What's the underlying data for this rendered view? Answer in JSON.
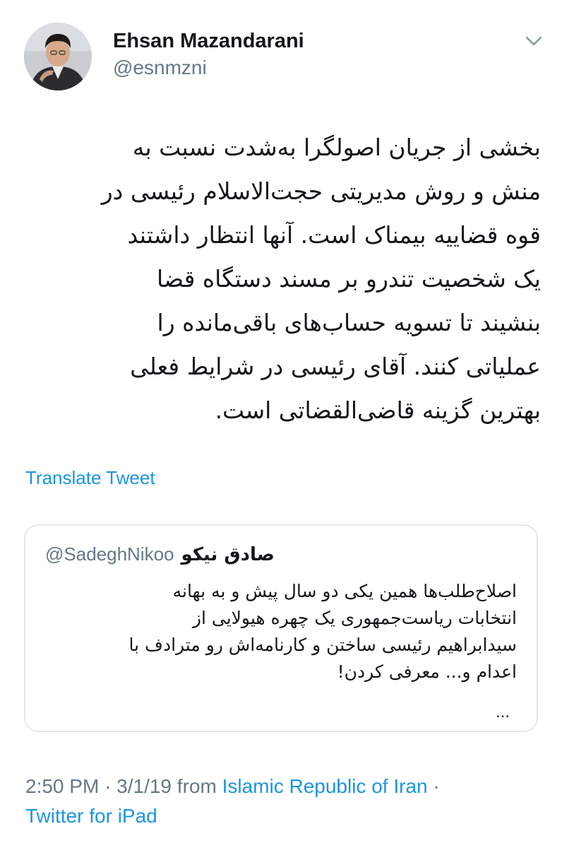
{
  "author": {
    "display_name": "Ehsan Mazandarani",
    "handle": "@esnmzni"
  },
  "tweet": {
    "lines": [
      "بخشی از جریان اصولگرا به‌شدت نسبت به",
      "منش و روش مدیریتی حجت‌الاسلام رئیسی در",
      "قوه قضاییه بیمناک است. آنها انتظار داشتند",
      "یک شخصیت تندرو بر مسند دستگاه قضا",
      "بنشیند تا تسویه حساب‌های باقی‌مانده را",
      "عملیاتی کنند. آقای رئیسی در شرایط فعلی",
      "بهترین گزینه قاضی‌القضاتی است."
    ],
    "translate_label": "Translate Tweet"
  },
  "quoted_tweet": {
    "name": "صادق نیکو",
    "handle": "@SadeghNikoo",
    "lines": [
      "اصلاح‌طلب‌ها همین یکی دو سال پیش و به بهانه",
      "انتخابات ریاست‌جمهوری یک چهره هیولایی از",
      "سیدابراهیم رئیسی ساختن و کارنامه‌اش رو مترادف با",
      "اعدام و... معرفی کردن!"
    ],
    "ellipsis": "..."
  },
  "meta": {
    "timestamp": "2:50 PM · 3/1/19 from ",
    "location": "Islamic Republic of Iran",
    "separator": " ·",
    "source": "Twitter for iPad"
  },
  "icons": {
    "caret": "chevron-down-icon"
  },
  "colors": {
    "link": "#1b95e0",
    "secondary_text": "#657786",
    "primary_text": "#14171a",
    "border": "#e1e8ed"
  }
}
